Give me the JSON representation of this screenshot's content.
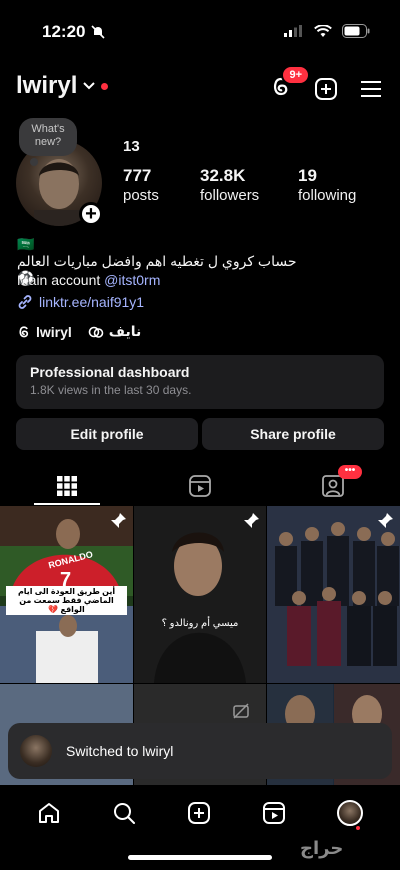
{
  "status_bar": {
    "time": "12:20"
  },
  "header": {
    "username": "lwiryl",
    "notification_badge": "9+"
  },
  "profile": {
    "note_text": "What's new?",
    "stats_top": "13",
    "posts_count": "777",
    "posts_label": "posts",
    "followers_count": "32.8K",
    "followers_label": "followers",
    "following_count": "19",
    "following_label": "following",
    "bio_line1_flag": "🇸🇦",
    "bio_line2": "حساب كروي ل تغطيه اهم وافضل مباريات العالم ⚽",
    "bio_line3_prefix": "Main account ",
    "bio_line3_mention": "@itst0rm",
    "link": "linktr.ee/naif91y1",
    "threads_name": "lwiryl",
    "threads_other": "نايف"
  },
  "dashboard": {
    "title": "Professional dashboard",
    "subtitle": "1.8K views in the last 30 days."
  },
  "buttons": {
    "edit": "Edit profile",
    "share": "Share profile"
  },
  "grid": {
    "captions": [
      "أين طريق العودة الى ايام الماضي فقط سمعت من الواقع 💔",
      "ميسي أم رونالدو ؟"
    ],
    "jersey_text": "RONALDO",
    "jersey_number": "7"
  },
  "toast": {
    "text": "Switched to lwiryl"
  },
  "watermark": "حراج",
  "colors": {
    "accent_red": "#ff3040",
    "link_blue": "#a6b5ff",
    "surface": "#1c1c1e"
  }
}
